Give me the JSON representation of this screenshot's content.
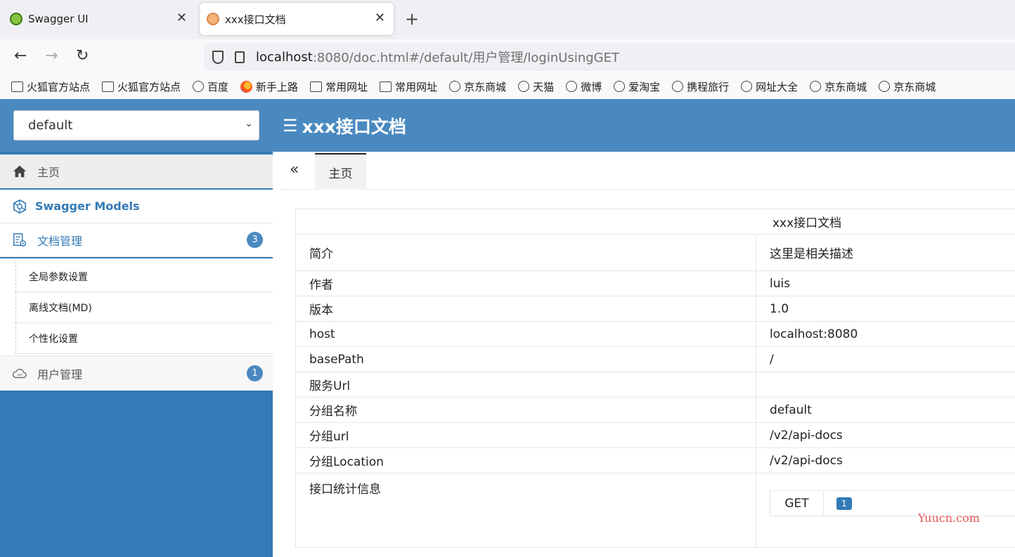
{
  "browser": {
    "tabs": [
      {
        "title": "Swagger UI",
        "active": false
      },
      {
        "title": "xxx接口文档",
        "active": true
      }
    ],
    "url": {
      "host": "localhost",
      "rest": ":8080/doc.html#/default/用户管理/loginUsingGET"
    },
    "bookmarks": [
      {
        "label": "火狐官方站点",
        "icon": "folder-icon"
      },
      {
        "label": "火狐官方站点",
        "icon": "folder-icon"
      },
      {
        "label": "百度",
        "icon": "globe-icon"
      },
      {
        "label": "新手上路",
        "icon": "firefox-icon"
      },
      {
        "label": "常用网址",
        "icon": "folder-icon"
      },
      {
        "label": "常用网址",
        "icon": "folder-icon"
      },
      {
        "label": "京东商城",
        "icon": "globe-icon"
      },
      {
        "label": "天猫",
        "icon": "globe-icon"
      },
      {
        "label": "微博",
        "icon": "globe-icon"
      },
      {
        "label": "爱淘宝",
        "icon": "globe-icon"
      },
      {
        "label": "携程旅行",
        "icon": "globe-icon"
      },
      {
        "label": "网址大全",
        "icon": "globe-icon"
      },
      {
        "label": "京东商城",
        "icon": "globe-icon"
      },
      {
        "label": "京东商城",
        "icon": "globe-icon"
      }
    ]
  },
  "header": {
    "group_select": "default",
    "title": "xxx接口文档"
  },
  "sidebar": {
    "home": "主页",
    "models": "Swagger Models",
    "docs": {
      "label": "文档管理",
      "badge": "3"
    },
    "sub_items": [
      "全局参数设置",
      "离线文档(MD)",
      "个性化设置"
    ],
    "users": {
      "label": "用户管理",
      "badge": "1"
    }
  },
  "main": {
    "tab": "主页",
    "table_title": "xxx接口文档",
    "rows": [
      {
        "key": "简介",
        "value": "这里是相关描述"
      },
      {
        "key": "作者",
        "value": "luis"
      },
      {
        "key": "版本",
        "value": "1.0"
      },
      {
        "key": "host",
        "value": "localhost:8080"
      },
      {
        "key": "basePath",
        "value": "/"
      },
      {
        "key": "服务Url",
        "value": ""
      },
      {
        "key": "分组名称",
        "value": "default"
      },
      {
        "key": "分组url",
        "value": "/v2/api-docs"
      },
      {
        "key": "分组Location",
        "value": "/v2/api-docs"
      }
    ],
    "stats_label": "接口统计信息",
    "stats": {
      "method": "GET",
      "count": "1"
    }
  },
  "watermark": "Yuucn.com",
  "colors": {
    "header": "#4a89c0",
    "sidebar": "#337ab7",
    "accent": "#337ab7"
  }
}
